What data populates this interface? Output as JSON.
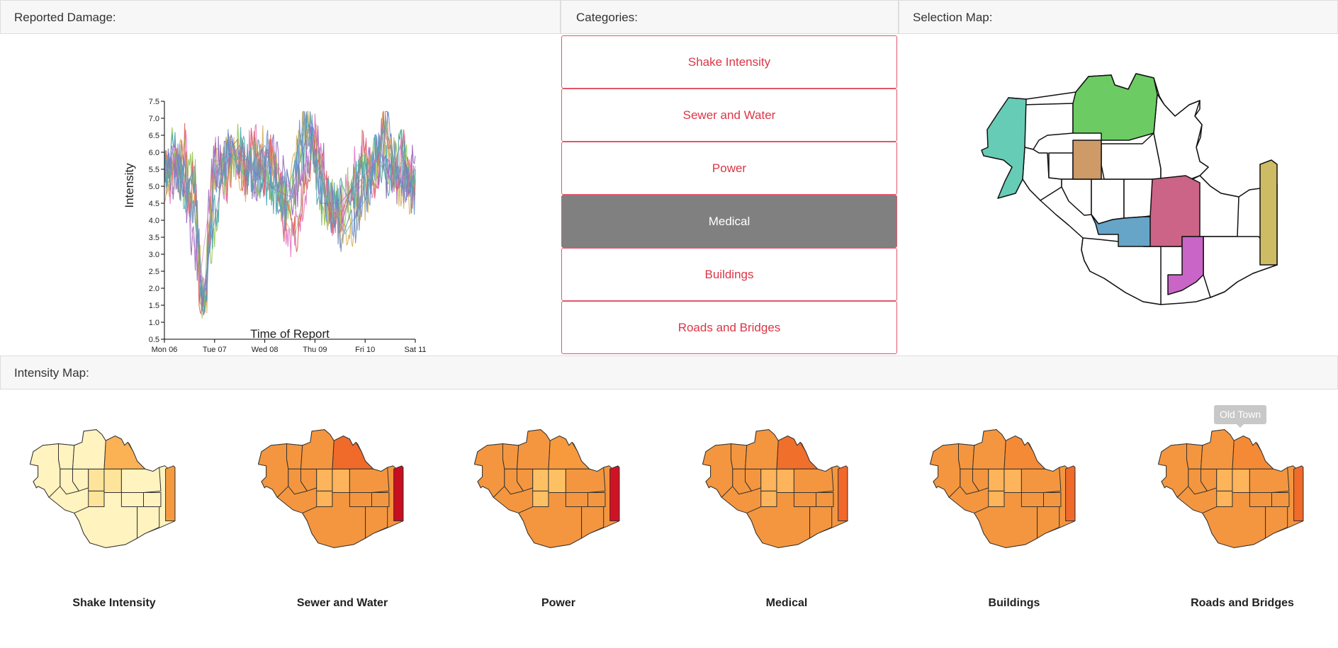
{
  "panels": {
    "damage_title": "Reported Damage:",
    "categories_title": "Categories:",
    "selection_title": "Selection Map:",
    "intensity_title": "Intensity Map:"
  },
  "categories": [
    {
      "label": "Shake Intensity",
      "active": false
    },
    {
      "label": "Sewer and Water",
      "active": false
    },
    {
      "label": "Power",
      "active": false
    },
    {
      "label": "Medical",
      "active": true
    },
    {
      "label": "Buildings",
      "active": false
    },
    {
      "label": "Roads and Bridges",
      "active": false
    }
  ],
  "intensity_maps": [
    {
      "label": "Shake Intensity",
      "base": "#fff3bf",
      "alt": "#fde49a",
      "hi": "#fbb254",
      "east": "#f59b3f"
    },
    {
      "label": "Sewer and Water",
      "base": "#f4963f",
      "alt": "#fdb45a",
      "hi": "#f06a2a",
      "east": "#c70f1f"
    },
    {
      "label": "Power",
      "base": "#f4963f",
      "alt": "#fdc063",
      "hi": "#f79a3e",
      "east": "#d01324"
    },
    {
      "label": "Medical",
      "base": "#f4963f",
      "alt": "#fdb45a",
      "hi": "#f06f2a",
      "east": "#f2682a"
    },
    {
      "label": "Buildings",
      "base": "#f4963f",
      "alt": "#fdb45a",
      "hi": "#f58a36",
      "east": "#f06a2a"
    },
    {
      "label": "Roads and Bridges",
      "base": "#f4963f",
      "alt": "#fdb45a",
      "hi": "#f58a36",
      "east": "#f06a2a"
    }
  ],
  "tooltip": "Old Town",
  "selection_colors": {
    "west": "#66ccb5",
    "north": "#6ccc63",
    "tan": "#cd9a68",
    "pink": "#cc6487",
    "blue": "#66a4c8",
    "magenta": "#c965c6",
    "east": "#cdbc63"
  },
  "chart_data": {
    "type": "line",
    "xlabel": "Time of Report",
    "ylabel": "Intensity",
    "x_ticks": [
      "Mon 06",
      "Tue 07",
      "Wed 08",
      "Thu 09",
      "Fri 10",
      "Sat 11"
    ],
    "xlim": [
      "Mon 06",
      "Sat 11"
    ],
    "y_ticks": [
      "0.5",
      "1.0",
      "1.5",
      "2.0",
      "2.5",
      "3.0",
      "3.5",
      "4.0",
      "4.5",
      "5.0",
      "5.5",
      "6.0",
      "6.5",
      "7.0",
      "7.5"
    ],
    "ylim": [
      0.5,
      7.5
    ],
    "series_colors": [
      "#e377c2",
      "#8fc450",
      "#d4b15a",
      "#9467bd",
      "#e0645a",
      "#4aa6b0",
      "#6a8fcf"
    ],
    "series": [
      {
        "x": [
          0.0,
          0.1,
          0.2,
          0.3,
          0.4,
          0.5,
          0.6,
          0.7,
          0.75,
          0.8,
          0.85,
          0.9,
          1.0,
          1.2,
          1.4,
          1.6,
          1.8,
          2.0,
          2.2,
          2.4,
          2.6,
          2.8,
          3.0,
          3.2,
          3.4,
          3.6,
          3.8,
          4.0,
          4.2,
          4.4,
          4.6,
          4.8,
          4.95,
          5.0
        ],
        "y": [
          5.6,
          5.0,
          6.0,
          5.2,
          6.4,
          4.5,
          5.5,
          2.0,
          1.1,
          1.6,
          3.5,
          4.0,
          5.8,
          5.0,
          6.0,
          5.5,
          6.3,
          5.5,
          6.0,
          4.0,
          3.5,
          5.0,
          6.5,
          4.8,
          4.0,
          4.5,
          5.5,
          6.0,
          5.0,
          7.0,
          5.3,
          6.0,
          5.0,
          5.3
        ]
      },
      {
        "x": [
          0.0,
          0.2,
          0.4,
          0.6,
          0.75,
          0.9,
          1.2,
          1.5,
          1.8,
          2.2,
          2.5,
          2.9,
          3.1,
          3.5,
          3.8,
          4.1,
          4.3,
          4.5,
          4.7,
          4.9,
          5.0
        ],
        "y": [
          5.3,
          6.2,
          4.8,
          5.6,
          1.5,
          3.2,
          5.6,
          6.2,
          5.4,
          4.9,
          4.7,
          6.8,
          4.5,
          4.5,
          5.0,
          5.5,
          6.0,
          5.2,
          6.2,
          5.0,
          5.6
        ]
      },
      {
        "x": [
          0.0,
          0.3,
          0.6,
          0.8,
          1.0,
          1.3,
          1.6,
          2.0,
          2.4,
          2.8,
          3.2,
          3.6,
          4.0,
          4.4,
          4.7,
          5.0
        ],
        "y": [
          5.1,
          5.8,
          4.3,
          1.7,
          5.5,
          6.0,
          5.3,
          6.2,
          4.4,
          7.0,
          4.8,
          3.6,
          4.6,
          6.8,
          5.0,
          4.8
        ]
      },
      {
        "x": [
          0.0,
          0.4,
          0.7,
          1.0,
          1.4,
          1.8,
          2.2,
          2.6,
          3.0,
          3.4,
          3.8,
          4.2,
          4.6,
          5.0
        ],
        "y": [
          5.6,
          5.1,
          2.2,
          5.7,
          6.1,
          5.2,
          5.8,
          4.6,
          6.6,
          4.1,
          4.7,
          5.8,
          5.1,
          5.5
        ]
      }
    ]
  }
}
